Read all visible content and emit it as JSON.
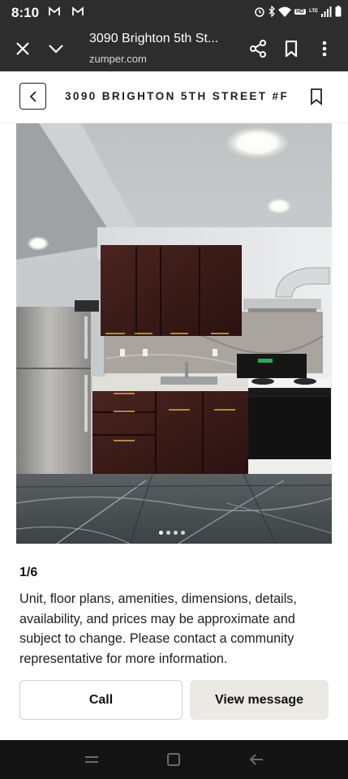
{
  "status_bar": {
    "time": "8:10",
    "notification_icons": [
      "gmail-icon",
      "gmail-icon"
    ],
    "system_icons": [
      "alarm-icon",
      "bluetooth-icon",
      "wifi-icon",
      "hd-icon",
      "lte-icon",
      "signal-icon",
      "battery-icon"
    ],
    "hd_label": "HD",
    "lte_label": "LTE"
  },
  "browser": {
    "page_title": "3090 Brighton 5th St...",
    "url": "zumper.com",
    "icons": [
      "close-icon",
      "chevron-down-icon",
      "share-icon",
      "bookmark-icon",
      "more-vert-icon"
    ]
  },
  "header": {
    "title": "3090 BRIGHTON 5TH STREET #F",
    "icons": [
      "back-arrow-icon",
      "bookmark-icon"
    ]
  },
  "gallery": {
    "counter": "1/6",
    "dots": 4,
    "active_dot": 0
  },
  "disclaimer": "Unit, floor plans, amenities, dimensions, details, availability, and prices may be approximate and subject to change. Please contact a community representative for more information.",
  "actions": {
    "call_label": "Call",
    "message_label": "View message"
  },
  "colors": {
    "chrome_bg": "#2d2d2d",
    "nav_bg": "#141414",
    "message_button_bg": "#ebe9e4"
  }
}
